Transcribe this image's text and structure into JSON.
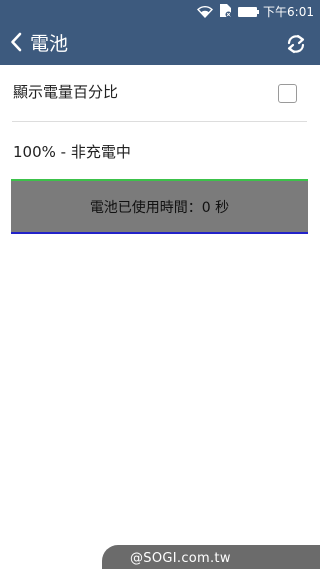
{
  "status_bar": {
    "time": "下午6:01",
    "icons": [
      "wifi-icon",
      "sim-card-icon",
      "battery-icon"
    ],
    "color": "#3d5a7e"
  },
  "app_bar": {
    "title": "電池",
    "back_icon": "chevron-left-icon",
    "refresh_icon": "refresh-icon",
    "color": "#3d5a7e"
  },
  "settings": {
    "show_percentage_label": "顯示電量百分比",
    "show_percentage_checked": false
  },
  "battery": {
    "status_text": "100% - 非充電中",
    "usage_caption": "電池已使用時間：0 秒",
    "graph_colors": {
      "top_line": "#3cc24a",
      "fill": "#7b7b7b",
      "bottom_line": "#2323c8"
    }
  },
  "watermark": {
    "text": "@SOGI.com.tw"
  }
}
